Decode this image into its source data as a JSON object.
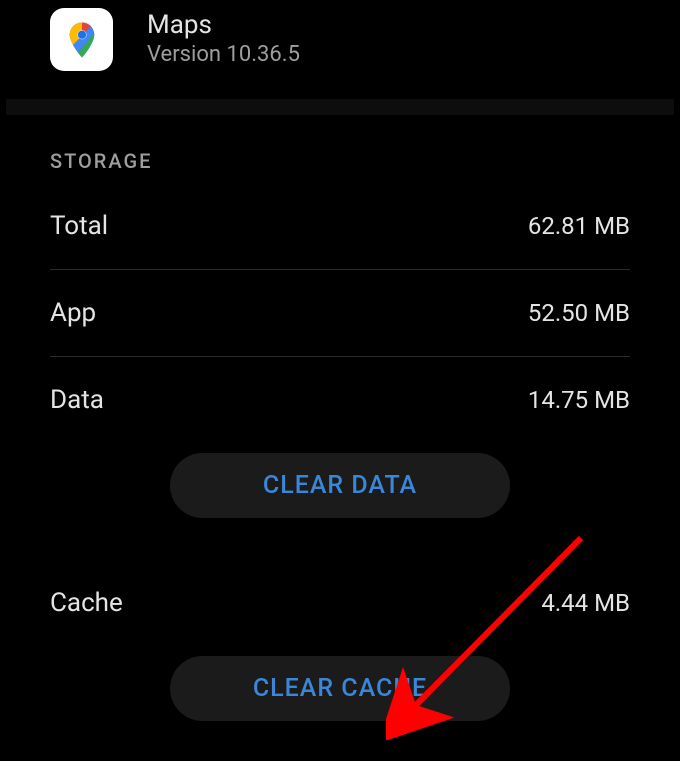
{
  "app": {
    "name": "Maps",
    "version_label": "Version 10.36.5"
  },
  "storage": {
    "section_title": "STORAGE",
    "rows": {
      "total": {
        "label": "Total",
        "value": "62.81 MB"
      },
      "app": {
        "label": "App",
        "value": "52.50 MB"
      },
      "data": {
        "label": "Data",
        "value": "14.75 MB"
      },
      "cache": {
        "label": "Cache",
        "value": "4.44 MB"
      }
    },
    "buttons": {
      "clear_data": "CLEAR DATA",
      "clear_cache": "CLEAR CACHE"
    }
  },
  "colors": {
    "accent": "#3a86d8",
    "arrow": "#ff0000"
  }
}
